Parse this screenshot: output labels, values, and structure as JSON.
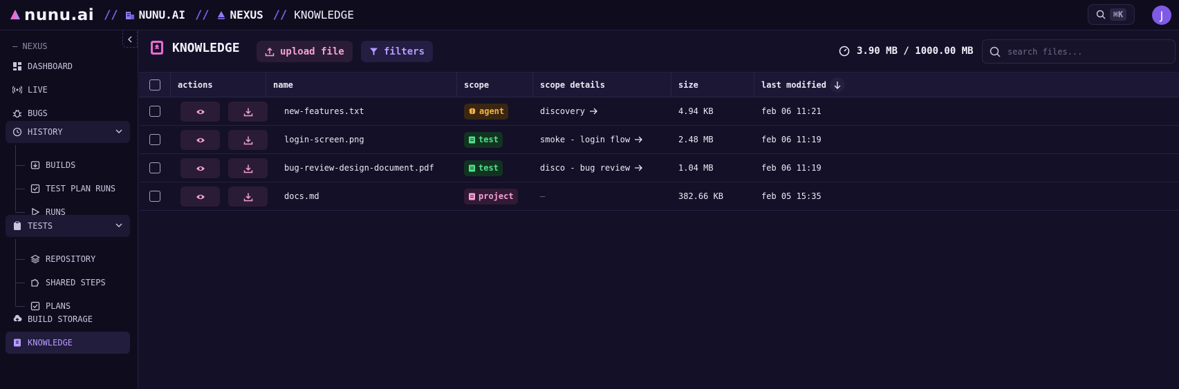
{
  "brand": {
    "name": "nunu.ai"
  },
  "breadcrumb": [
    {
      "label": "NUNU.AI",
      "icon": "building-icon"
    },
    {
      "label": "NEXUS",
      "icon": "boat-icon"
    },
    {
      "label": "KNOWLEDGE"
    }
  ],
  "breadcrumb_separator": "//",
  "search_shortcut": "⌘K",
  "user": {
    "initial": "J"
  },
  "sidebar": {
    "section": "— NEXUS",
    "items": [
      {
        "label": "DASHBOARD",
        "icon": "dashboard-icon"
      },
      {
        "label": "LIVE",
        "icon": "broadcast-icon"
      },
      {
        "label": "BUGS",
        "icon": "bug-icon"
      },
      {
        "label": "HISTORY",
        "icon": "clock-icon",
        "expanded": true,
        "children": [
          {
            "label": "BUILDS",
            "icon": "build-box-icon"
          },
          {
            "label": "TEST PLAN RUNS",
            "icon": "checkbox-icon"
          },
          {
            "label": "RUNS",
            "icon": "play-icon"
          }
        ]
      },
      {
        "label": "TESTS",
        "icon": "clipboard-icon",
        "expanded": true,
        "children": [
          {
            "label": "REPOSITORY",
            "icon": "layers-icon"
          },
          {
            "label": "SHARED STEPS",
            "icon": "puzzle-icon"
          },
          {
            "label": "PLANS",
            "icon": "checkbox-icon"
          }
        ]
      },
      {
        "label": "BUILD STORAGE",
        "icon": "cloud-upload-icon"
      },
      {
        "label": "KNOWLEDGE",
        "icon": "book-icon",
        "active": true
      }
    ]
  },
  "main": {
    "title": "KNOWLEDGE",
    "upload_label": "upload file",
    "filters_label": "filters",
    "storage_usage": "3.90 MB / 1000.00 MB",
    "search_placeholder": "search files..."
  },
  "table": {
    "columns": [
      "actions",
      "name",
      "scope",
      "scope details",
      "size",
      "last modified"
    ],
    "sort_column": "last modified",
    "sort_direction": "descending",
    "rows": [
      {
        "name": "new-features.txt",
        "scope": "agent",
        "scope_details": "discovery",
        "has_link": true,
        "size": "4.94 KB",
        "modified": "feb 06 11:21"
      },
      {
        "name": "login-screen.png",
        "scope": "test",
        "scope_details": "smoke - login flow",
        "has_link": true,
        "size": "2.48 MB",
        "modified": "feb 06 11:19"
      },
      {
        "name": "bug-review-design-document.pdf",
        "scope": "test",
        "scope_details": "disco - bug review",
        "has_link": true,
        "size": "1.04 MB",
        "modified": "feb 06 11:19"
      },
      {
        "name": "docs.md",
        "scope": "project",
        "scope_details": "—",
        "has_link": false,
        "size": "382.66 KB",
        "modified": "feb 05 15:35"
      }
    ]
  },
  "colors": {
    "accent_purple": "#7a63e8",
    "accent_pink": "#f4a1d4",
    "agent_badge": "#f5b342",
    "test_badge": "#4fe08a",
    "background": "#131025"
  }
}
